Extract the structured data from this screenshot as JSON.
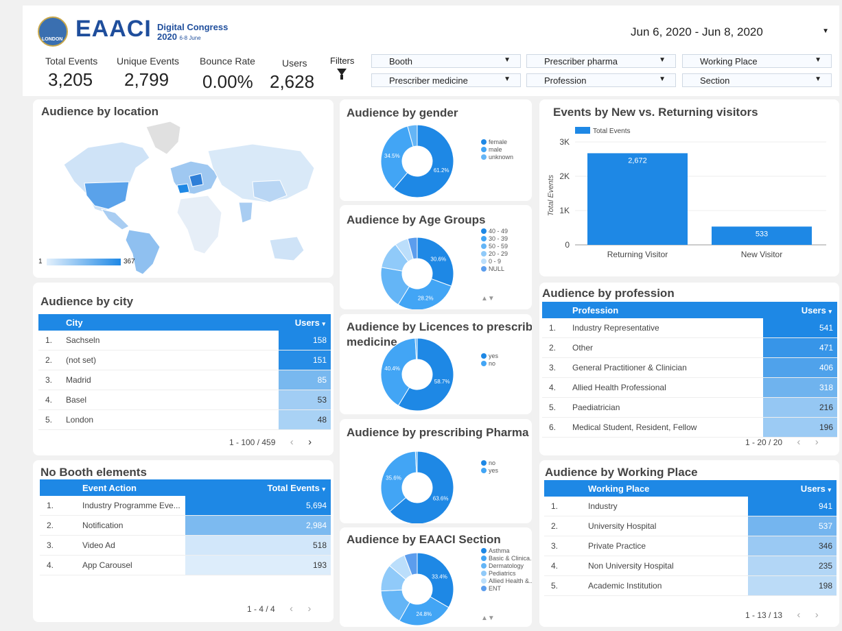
{
  "header": {
    "brand": "EAACI",
    "sub_title": "Digital Congress",
    "sub_year": "2020",
    "sub_dates": "6-8 June",
    "logo_text": "LONDON",
    "date_range": "Jun 6, 2020 - Jun 8, 2020"
  },
  "kpis": [
    {
      "label": "Total Events",
      "value": "3,205"
    },
    {
      "label": "Unique Events",
      "value": "2,799"
    },
    {
      "label": "Bounce Rate",
      "value": "0.00%"
    },
    {
      "label": "Users",
      "value": "2,628"
    }
  ],
  "filters": {
    "label": "Filters",
    "dropdowns": [
      "Booth",
      "Prescriber pharma",
      "Working Place",
      "Prescriber medicine",
      "Profession",
      "Section"
    ]
  },
  "location": {
    "title": "Audience by location",
    "scale_min": "1",
    "scale_max": "367"
  },
  "city": {
    "title": "Audience by city",
    "col1": "City",
    "col2": "Users",
    "rows": [
      {
        "idx": "1.",
        "name": "Sachseln",
        "val": "158",
        "frac": 1.0
      },
      {
        "idx": "2.",
        "name": "(not set)",
        "val": "151",
        "frac": 0.96
      },
      {
        "idx": "3.",
        "name": "Madrid",
        "val": "85",
        "frac": 0.54
      },
      {
        "idx": "4.",
        "name": "Basel",
        "val": "53",
        "frac": 0.34
      },
      {
        "idx": "5.",
        "name": "London",
        "val": "48",
        "frac": 0.3
      }
    ],
    "pager": "1 - 100 / 459"
  },
  "booth": {
    "title": "No Booth elements",
    "col1": "Event Action",
    "col2": "Total Events",
    "rows": [
      {
        "idx": "1.",
        "name": "Industry Programme Eve...",
        "val": "5,694",
        "frac": 1.0
      },
      {
        "idx": "2.",
        "name": "Notification",
        "val": "2,984",
        "frac": 0.52
      },
      {
        "idx": "3.",
        "name": "Video Ad",
        "val": "518",
        "frac": 0.09
      },
      {
        "idx": "4.",
        "name": "App Carousel",
        "val": "193",
        "frac": 0.03
      }
    ],
    "pager": "1 - 4 / 4"
  },
  "gender": {
    "title": "Audience by gender",
    "legend": [
      "female",
      "male",
      "unknown"
    ],
    "slices": [
      61.2,
      34.5,
      4.3
    ],
    "labels": [
      "61.2%",
      "34.5%",
      ""
    ]
  },
  "age": {
    "title": "Audience by Age Groups",
    "legend": [
      "40 - 49",
      "30 - 39",
      "50 - 59",
      "20 - 29",
      "0 - 9",
      "NULL"
    ],
    "slices": [
      30.6,
      28.2,
      19.0,
      12.0,
      6.0,
      4.2
    ],
    "labels": [
      "30.6%",
      "28.2%",
      "",
      "",
      "",
      ""
    ]
  },
  "licences": {
    "title": "Audience by Licences to prescribe medicine",
    "title_l1": "Audience by Licences to prescribe",
    "title_l2": "medicine",
    "legend": [
      "yes",
      "no"
    ],
    "slices": [
      58.7,
      40.4,
      0.9
    ],
    "labels": [
      "58.7%",
      "40.4%",
      ""
    ]
  },
  "pharma": {
    "title": "Audience by prescribing Pharma",
    "legend": [
      "no",
      "yes"
    ],
    "slices": [
      63.6,
      35.6,
      0.8
    ],
    "labels": [
      "63.6%",
      "35.6%",
      ""
    ]
  },
  "section": {
    "title": "Audience by EAACI Section",
    "legend": [
      "Asthma",
      "Basic & Clinica...",
      "Dermatology",
      "Pediatrics",
      "Allied Health &...",
      "ENT"
    ],
    "slices": [
      33.4,
      24.8,
      16.0,
      12.0,
      8.0,
      5.8
    ],
    "labels": [
      "33.4%",
      "24.8%",
      "",
      "",
      "",
      ""
    ]
  },
  "visitors": {
    "title": "Events by New vs. Returning visitors",
    "legend": "Total Events",
    "ylabel": "Total Events",
    "ticks": [
      "0",
      "1K",
      "2K",
      "3K"
    ]
  },
  "chart_data": {
    "type": "bar",
    "title": "Events by New vs. Returning visitors",
    "categories": [
      "Returning Visitor",
      "New Visitor"
    ],
    "series": [
      {
        "name": "Total Events",
        "values": [
          2672,
          533
        ]
      }
    ],
    "value_labels": [
      "2,672",
      "533"
    ],
    "ylabel": "Total Events",
    "ylim": [
      0,
      3000
    ],
    "legend_position": "top-left",
    "grid": true
  },
  "profession": {
    "title": "Audience by profession",
    "col1": "Profession",
    "col2": "Users",
    "rows": [
      {
        "idx": "1.",
        "name": "Industry Representative",
        "val": "541",
        "frac": 1.0
      },
      {
        "idx": "2.",
        "name": "Other",
        "val": "471",
        "frac": 0.87
      },
      {
        "idx": "3.",
        "name": "General Practitioner & Clinician",
        "val": "406",
        "frac": 0.75
      },
      {
        "idx": "4.",
        "name": "Allied Health Professional",
        "val": "318",
        "frac": 0.59
      },
      {
        "idx": "5.",
        "name": "Paediatrician",
        "val": "216",
        "frac": 0.4
      },
      {
        "idx": "6.",
        "name": "Medical Student, Resident, Fellow",
        "val": "196",
        "frac": 0.36
      }
    ],
    "pager": "1 - 20 / 20"
  },
  "working": {
    "title": "Audience by Working Place",
    "col1": "Working Place",
    "col2": "Users",
    "rows": [
      {
        "idx": "1.",
        "name": "Industry",
        "val": "941",
        "frac": 1.0
      },
      {
        "idx": "2.",
        "name": "University Hospital",
        "val": "537",
        "frac": 0.57
      },
      {
        "idx": "3.",
        "name": "Private Practice",
        "val": "346",
        "frac": 0.37
      },
      {
        "idx": "4.",
        "name": "Non University Hospital",
        "val": "235",
        "frac": 0.25
      },
      {
        "idx": "5.",
        "name": "Academic Institution",
        "val": "198",
        "frac": 0.21
      }
    ],
    "pager": "1 - 13 / 13"
  },
  "colors": {
    "accent": "#1e88e5",
    "pie": [
      "#1e88e5",
      "#42a5f5",
      "#64b5f6",
      "#90caf9",
      "#bbdefb",
      "#5c9ded"
    ]
  }
}
